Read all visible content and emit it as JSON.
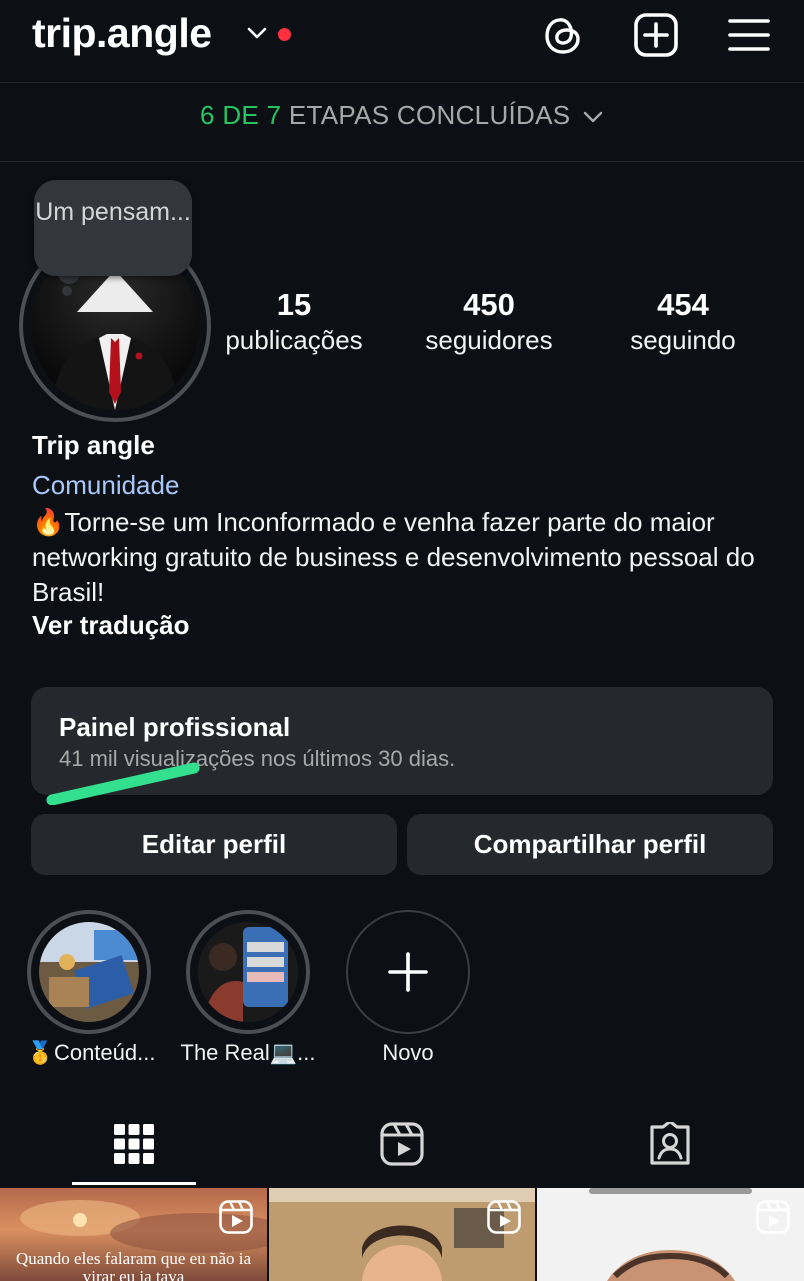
{
  "header": {
    "username": "trip.angle",
    "icons": [
      "threads-icon",
      "create-icon",
      "menu-icon"
    ]
  },
  "steps": {
    "done": "6 DE 7",
    "rest": "ETAPAS CONCLUÍDAS"
  },
  "note": {
    "text": "Um pensam..."
  },
  "stats": {
    "posts": {
      "num": "15",
      "label": "publicações"
    },
    "followers": {
      "num": "450",
      "label": "seguidores"
    },
    "following": {
      "num": "454",
      "label": "seguindo"
    }
  },
  "profile": {
    "name": "Trip angle",
    "category": "Comunidade",
    "bio": "🔥Torne-se um Inconformado e venha fazer parte do maior networking gratuito de business e desenvolvimento pessoal do Brasil!",
    "translate": "Ver tradução"
  },
  "panel": {
    "title": "Painel profissional",
    "subtitle": "41 mil visualizações nos últimos 30 dias."
  },
  "buttons": {
    "edit": "Editar perfil",
    "share": "Compartilhar perfil"
  },
  "highlights": [
    {
      "label": "🥇Conteúd..."
    },
    {
      "label": "The Real💻..."
    },
    {
      "label": "Novo"
    }
  ],
  "tabs": [
    "grid-icon",
    "reels-icon",
    "tagged-icon"
  ],
  "grid": [
    {
      "caption": "Quando eles falaram que eu não ia virar eu ia tava"
    },
    {
      "caption": ""
    },
    {
      "caption": ""
    }
  ],
  "colors": {
    "accent_green": "#24c660",
    "link_blue": "#a8c7fa",
    "dot_red": "#ff3040",
    "background": "#0c1014"
  }
}
